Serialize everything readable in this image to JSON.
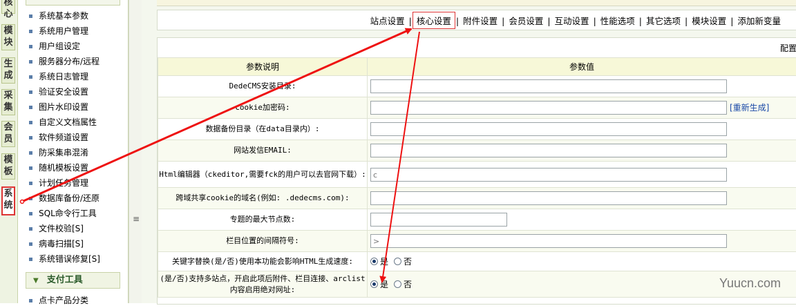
{
  "leftnav": {
    "tabs": [
      {
        "label": "核心",
        "active": false
      },
      {
        "label": "模块",
        "active": false
      },
      {
        "label": "生成",
        "active": false
      },
      {
        "label": "采集",
        "active": false
      },
      {
        "label": "会员",
        "active": false
      },
      {
        "label": "模板",
        "active": false
      },
      {
        "label": "系统",
        "active": true
      }
    ]
  },
  "menu": {
    "items": [
      "系统基本参数",
      "系统用户管理",
      "用户组设定",
      "服务器分布/远程",
      "系统日志管理",
      "验证安全设置",
      "图片水印设置",
      "自定义文档属性",
      "软件频道设置",
      "防采集串混淆",
      "随机模板设置",
      "计划任务管理",
      "数据库备份/还原",
      "SQL命令行工具",
      "文件校验[S]",
      "病毒扫描[S]",
      "系统错误修复[S]"
    ],
    "section2_title": "支付工具",
    "section2_first_item": "点卡产品分类"
  },
  "splitter": {
    "grip": "≡"
  },
  "tabs": [
    "站点设置",
    "核心设置",
    "附件设置",
    "会员设置",
    "互动设置",
    "性能选项",
    "其它选项",
    "模块设置",
    "添加新变量"
  ],
  "active_tab": "核心设置",
  "panel": {
    "corner_label": "配置",
    "header": {
      "col1": "参数说明",
      "col2": "参数值"
    },
    "regen_label": "[重新生成]",
    "rows": [
      {
        "label": "DedeCMS安装目录:",
        "value": ""
      },
      {
        "label": "cookie加密码:",
        "value": ""
      },
      {
        "label": "数据备份目录（在data目录内）:",
        "value": ""
      },
      {
        "label": "网站发信EMAIL:",
        "value": ""
      },
      {
        "label": "Html编辑器（ckeditor,需要fck的用户可以去官网下载）:",
        "value": "c"
      },
      {
        "label": "跨域共享cookie的域名(例如: .dedecms.com):",
        "value": ""
      },
      {
        "label": "专题的最大节点数:",
        "value": ""
      },
      {
        "label": "栏目位置的间隔符号:",
        "value": ">"
      },
      {
        "label": "关键字替换(是/否)使用本功能会影响HTML生成速度:",
        "yes": "是",
        "no": "否"
      },
      {
        "label": "(是/否)支持多站点，开启此项后附件、栏目连接、arclist内容启用绝对网址:",
        "yes": "是",
        "no": "否"
      }
    ]
  },
  "watermark": "Yuucn.com",
  "colors": {
    "annotation_red": "#ee1111",
    "accent_green": "#2a5a2a"
  }
}
